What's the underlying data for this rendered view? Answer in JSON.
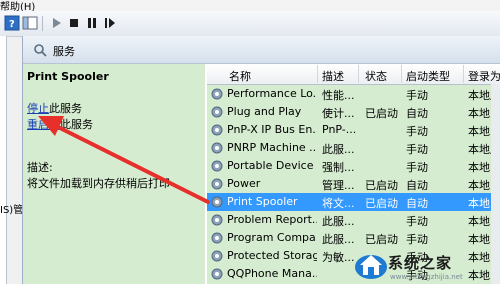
{
  "menu": {
    "help_label": "帮助(H)"
  },
  "left_edge_text": "IS)管",
  "pane": {
    "title": "服务"
  },
  "description": {
    "service_name": "Print Spooler",
    "stop_link": "停止",
    "stop_suffix": "此服务",
    "restart_link": "重启动",
    "restart_suffix": "此服务",
    "desc_label": "描述:",
    "desc_text": "将文件加载到内存供稍后打印"
  },
  "table": {
    "columns": [
      "名称",
      "描述",
      "状态",
      "启动类型",
      "登录为"
    ],
    "rows": [
      {
        "name": "Performance Lo...",
        "desc": "性能...",
        "status": "",
        "startup": "手动",
        "logon": "本地服务"
      },
      {
        "name": "Plug and Play",
        "desc": "使计...",
        "status": "已启动",
        "startup": "自动",
        "logon": "本地系统"
      },
      {
        "name": "PnP-X IP Bus En...",
        "desc": "PnP-...",
        "status": "",
        "startup": "手动",
        "logon": "本地系统"
      },
      {
        "name": "PNRP Machine ...",
        "desc": "此服...",
        "status": "",
        "startup": "手动",
        "logon": "本地服务"
      },
      {
        "name": "Portable Device ...",
        "desc": "强制...",
        "status": "",
        "startup": "手动",
        "logon": "本地系统"
      },
      {
        "name": "Power",
        "desc": "管理...",
        "status": "已启动",
        "startup": "自动",
        "logon": "本地系统"
      },
      {
        "name": "Print Spooler",
        "desc": "将文...",
        "status": "已启动",
        "startup": "自动",
        "logon": "本地系统"
      },
      {
        "name": "Problem Report...",
        "desc": "此服...",
        "status": "",
        "startup": "手动",
        "logon": "本地系统"
      },
      {
        "name": "Program Compa...",
        "desc": "此服...",
        "status": "已启动",
        "startup": "手动",
        "logon": "本地系统"
      },
      {
        "name": "Protected Storage",
        "desc": "为敏...",
        "status": "",
        "startup": "手动",
        "logon": "本地系统"
      },
      {
        "name": "QQPhone Mana...",
        "desc": "",
        "status": "",
        "startup": "手动",
        "logon": "本地系统"
      }
    ],
    "selected_index": 6
  },
  "watermark": {
    "text": "系统之家",
    "url": "www.xitongzhijia.net"
  },
  "colors": {
    "selection": "#3399ff",
    "panel_green": "#d5ecd0",
    "link": "#1a3fb3",
    "arrow": "#e8302a"
  },
  "icons": [
    "help-icon",
    "panel-icon",
    "play-icon",
    "stop-icon",
    "pause-icon",
    "restart-icon",
    "search-icon",
    "gear-icon"
  ]
}
